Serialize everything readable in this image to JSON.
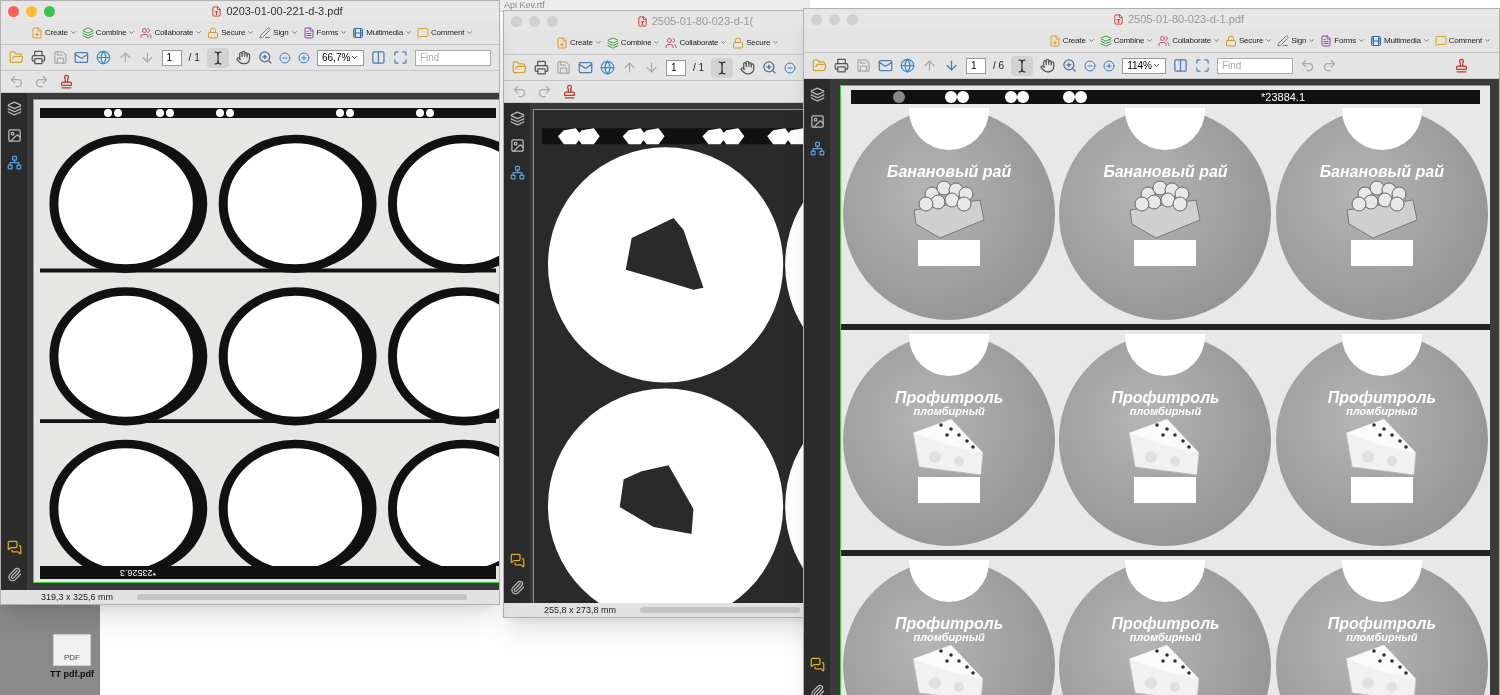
{
  "desktop": {
    "background_window_title": "Api Kev.rtf",
    "file": {
      "badge": "PDF",
      "label": "TT pdf.pdf"
    }
  },
  "windows": [
    {
      "title": "0203-01-00-221-d-3.pdf",
      "focused": true,
      "menus": [
        "Create",
        "Combine",
        "Collaborate",
        "Secure",
        "Sign",
        "Forms",
        "Multimedia",
        "Comment"
      ],
      "page": "1",
      "page_count": "/ 1",
      "zoom": "66,7%",
      "find_placeholder": "Find",
      "second_row": true,
      "page_size": "319,3 x 325,6 mm",
      "document": {
        "kind": "blob_sheet",
        "strip_text": "*23526.3"
      }
    },
    {
      "title": "2505-01-80-023-d-1(",
      "focused": false,
      "menus": [
        "Create",
        "Combine",
        "Collaborate",
        "Secure"
      ],
      "page": "1",
      "page_count": "/ 1",
      "second_row": true,
      "page_size": "255,8 x 273,8 mm",
      "document": {
        "kind": "cutout_sheet"
      }
    },
    {
      "title": "2505-01-80-023-d-1.pdf",
      "focused": false,
      "menus": [
        "Create",
        "Combine",
        "Collaborate",
        "Secure",
        "Sign",
        "Forms",
        "Multimedia",
        "Comment"
      ],
      "page": "1",
      "page_count": "/ 6",
      "zoom": "114%",
      "find_placeholder": "Find",
      "second_row": false,
      "document": {
        "kind": "label_sheet",
        "strip_text": "*23884.1",
        "labels": [
          {
            "title": "Банановый рай",
            "kind": "banana"
          },
          {
            "title": "Банановый рай",
            "kind": "banana"
          },
          {
            "title": "Банановый рай",
            "kind": "banana"
          },
          {
            "title": "Профитроль",
            "subtitle": "пломбирный",
            "kind": "cheese"
          },
          {
            "title": "Профитроль",
            "subtitle": "пломбирный",
            "kind": "cheese"
          },
          {
            "title": "Профитроль",
            "subtitle": "пломбирный",
            "kind": "cheese"
          },
          {
            "title": "Профитроль",
            "subtitle": "пломбирный",
            "kind": "cheese"
          },
          {
            "title": "Профитроль",
            "subtitle": "пломбирный",
            "kind": "cheese"
          },
          {
            "title": "Профитроль",
            "subtitle": "пломбирный",
            "kind": "cheese"
          }
        ]
      }
    }
  ]
}
